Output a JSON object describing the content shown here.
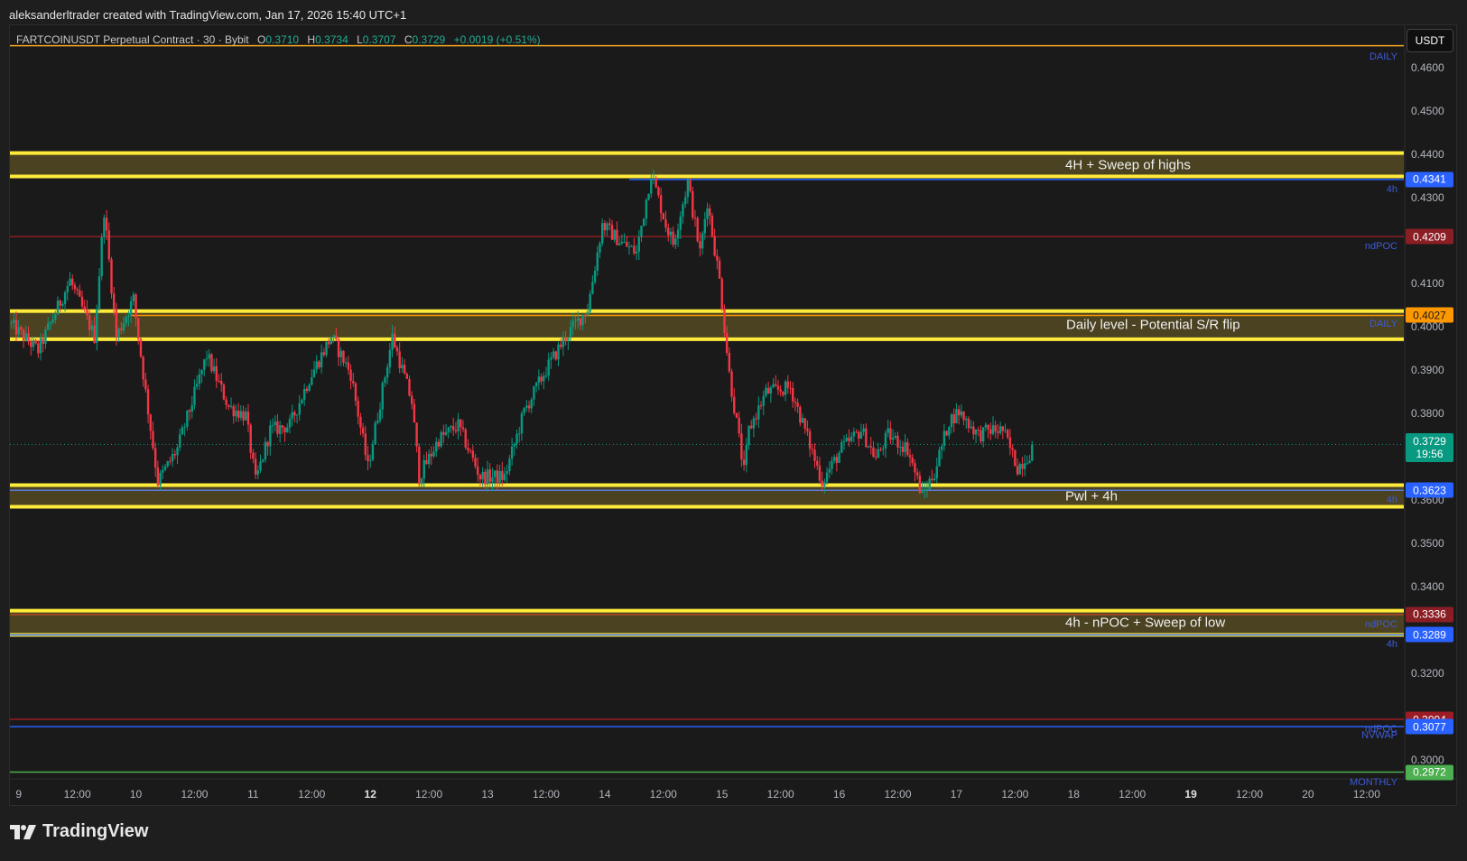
{
  "credit": "aleksanderltrader created with TradingView.com, Jan 17, 2026 15:40 UTC+1",
  "legend": {
    "symbol": "FARTCOINUSDT Perpetual Contract · 30 · Bybit",
    "o_label": "O",
    "o": "0.3710",
    "h_label": "H",
    "h": "0.3734",
    "l_label": "L",
    "l": "0.3707",
    "c_label": "C",
    "c": "0.3729",
    "change": "+0.0019 (+0.51%)"
  },
  "currency_button": "USDT",
  "brand": "TradingView",
  "chart_data": {
    "type": "candlestick",
    "timeframe": "30",
    "ylim": [
      0.2955,
      0.467
    ],
    "y_ticks": [
      "0.4600",
      "0.4500",
      "0.4400",
      "0.4300",
      "0.4100",
      "0.4000",
      "0.3900",
      "0.3800",
      "0.3600",
      "0.3500",
      "0.3400",
      "0.3200",
      "0.3000"
    ],
    "x_ticks": [
      {
        "t": "2026-01-09T00:00",
        "label": "9"
      },
      {
        "t": "2026-01-09T12:00",
        "label": "12:00"
      },
      {
        "t": "2026-01-10T00:00",
        "label": "10"
      },
      {
        "t": "2026-01-10T12:00",
        "label": "12:00"
      },
      {
        "t": "2026-01-11T00:00",
        "label": "11"
      },
      {
        "t": "2026-01-11T12:00",
        "label": "12:00"
      },
      {
        "t": "2026-01-12T00:00",
        "label": "12",
        "bold": true
      },
      {
        "t": "2026-01-12T12:00",
        "label": "12:00"
      },
      {
        "t": "2026-01-13T00:00",
        "label": "13"
      },
      {
        "t": "2026-01-13T12:00",
        "label": "12:00"
      },
      {
        "t": "2026-01-14T00:00",
        "label": "14"
      },
      {
        "t": "2026-01-14T12:00",
        "label": "12:00"
      },
      {
        "t": "2026-01-15T00:00",
        "label": "15"
      },
      {
        "t": "2026-01-15T12:00",
        "label": "12:00"
      },
      {
        "t": "2026-01-16T00:00",
        "label": "16"
      },
      {
        "t": "2026-01-16T12:00",
        "label": "12:00"
      },
      {
        "t": "2026-01-17T00:00",
        "label": "17"
      },
      {
        "t": "2026-01-17T12:00",
        "label": "12:00"
      },
      {
        "t": "2026-01-18T00:00",
        "label": "18"
      },
      {
        "t": "2026-01-18T12:00",
        "label": "12:00"
      },
      {
        "t": "2026-01-19T00:00",
        "label": "19",
        "bold": true
      },
      {
        "t": "2026-01-19T12:00",
        "label": "12:00"
      },
      {
        "t": "2026-01-20T00:00",
        "label": "20"
      },
      {
        "t": "2026-01-20T12:00",
        "label": "12:00"
      }
    ],
    "price_path": [
      [
        "2026-01-08T22:00",
        0.401
      ],
      [
        "2026-01-09T04:00",
        0.3946
      ],
      [
        "2026-01-09T10:30",
        0.4108
      ],
      [
        "2026-01-09T15:30",
        0.3978
      ],
      [
        "2026-01-09T17:30",
        0.427
      ],
      [
        "2026-01-09T20:00",
        0.3978
      ],
      [
        "2026-01-09T23:30",
        0.4065
      ],
      [
        "2026-01-10T02:00",
        0.3849
      ],
      [
        "2026-01-10T04:30",
        0.3643
      ],
      [
        "2026-01-10T08:30",
        0.3719
      ],
      [
        "2026-01-10T14:30",
        0.3935
      ],
      [
        "2026-01-10T19:00",
        0.3816
      ],
      [
        "2026-01-10T22:30",
        0.3795
      ],
      [
        "2026-01-11T00:30",
        0.3643
      ],
      [
        "2026-01-11T03:30",
        0.3762
      ],
      [
        "2026-01-11T07:30",
        0.3773
      ],
      [
        "2026-01-11T11:30",
        0.3881
      ],
      [
        "2026-01-11T16:00",
        0.3978
      ],
      [
        "2026-01-11T20:00",
        0.3892
      ],
      [
        "2026-01-11T23:30",
        0.3676
      ],
      [
        "2026-01-12T04:30",
        0.3978
      ],
      [
        "2026-01-12T08:30",
        0.3827
      ],
      [
        "2026-01-12T10:00",
        0.3654
      ],
      [
        "2026-01-12T14:00",
        0.3741
      ],
      [
        "2026-01-12T18:00",
        0.3773
      ],
      [
        "2026-01-12T22:30",
        0.3654
      ],
      [
        "2026-01-13T03:30",
        0.3654
      ],
      [
        "2026-01-13T07:30",
        0.3805
      ],
      [
        "2026-01-13T11:30",
        0.3892
      ],
      [
        "2026-01-13T16:00",
        0.3978
      ],
      [
        "2026-01-13T20:30",
        0.4043
      ],
      [
        "2026-01-13T23:30",
        0.4237
      ],
      [
        "2026-01-14T03:30",
        0.4194
      ],
      [
        "2026-01-14T06:30",
        0.4172
      ],
      [
        "2026-01-14T09:30",
        0.4356
      ],
      [
        "2026-01-14T12:30",
        0.4237
      ],
      [
        "2026-01-14T14:00",
        0.4194
      ],
      [
        "2026-01-14T17:00",
        0.4334
      ],
      [
        "2026-01-14T19:30",
        0.4172
      ],
      [
        "2026-01-14T21:00",
        0.4291
      ],
      [
        "2026-01-14T23:30",
        0.4108
      ],
      [
        "2026-01-15T01:30",
        0.3892
      ],
      [
        "2026-01-15T04:30",
        0.3665
      ],
      [
        "2026-01-15T05:30",
        0.3762
      ],
      [
        "2026-01-15T09:00",
        0.3849
      ],
      [
        "2026-01-15T14:00",
        0.386
      ],
      [
        "2026-01-15T17:00",
        0.3762
      ],
      [
        "2026-01-15T20:30",
        0.3643
      ],
      [
        "2026-01-16T00:30",
        0.3719
      ],
      [
        "2026-01-16T04:30",
        0.3762
      ],
      [
        "2026-01-16T07:30",
        0.3697
      ],
      [
        "2026-01-16T10:00",
        0.3751
      ],
      [
        "2026-01-16T14:00",
        0.3719
      ],
      [
        "2026-01-16T17:00",
        0.3611
      ],
      [
        "2026-01-16T19:30",
        0.3665
      ],
      [
        "2026-01-16T22:30",
        0.3784
      ],
      [
        "2026-01-17T00:30",
        0.3805
      ],
      [
        "2026-01-17T04:30",
        0.3751
      ],
      [
        "2026-01-17T07:00",
        0.3762
      ],
      [
        "2026-01-17T09:30",
        0.3762
      ],
      [
        "2026-01-17T12:30",
        0.3676
      ],
      [
        "2026-01-17T15:00",
        0.3708
      ],
      [
        "2026-01-17T15:30",
        0.3729
      ]
    ],
    "last_price": {
      "value": "0.3729",
      "countdown": "19:56",
      "color": "#089981"
    },
    "zones": [
      {
        "top": 0.4402,
        "bottom": 0.4348,
        "label": "4H + Sweep of highs"
      },
      {
        "top": 0.4037,
        "bottom": 0.3972,
        "label": "Daily level - Potential S/R flip"
      },
      {
        "top": 0.3635,
        "bottom": 0.3585,
        "label": "Pwl + 4h"
      },
      {
        "top": 0.3345,
        "bottom": 0.3289,
        "label": "4h - nPOC + Sweep of low"
      }
    ],
    "levels": [
      {
        "price": 0.465,
        "color": "#f5a623",
        "tag": "DAILY"
      },
      {
        "price": 0.4341,
        "color": "#2962ff",
        "tag": "4h",
        "badge": "0.4341",
        "start": "2026-01-14T05:00"
      },
      {
        "price": 0.4209,
        "color": "#8b1e24",
        "tag": "ndPOC",
        "badge": "0.4209"
      },
      {
        "price": 0.4027,
        "color": "#ff9800",
        "tag": "DAILY",
        "badge": "0.4027",
        "start": "2026-01-09T23:00"
      },
      {
        "price": 0.3623,
        "color": "#5b7bd6",
        "tag": "4h",
        "badge": "0.3623"
      },
      {
        "price": 0.3336,
        "color": "#b24a2a",
        "tag": "ndPOC",
        "badge": "0.3336"
      },
      {
        "price": 0.3289,
        "color": "#2962ff",
        "tag": "4h",
        "badge": "0.3289"
      },
      {
        "price": 0.3094,
        "color": "#9b1c24",
        "tag": "ndPOC",
        "badge": "0.3094"
      },
      {
        "price": 0.3077,
        "color": "#2962ff",
        "tag": "NVWAP",
        "badge": "0.3077"
      },
      {
        "price": 0.2972,
        "color": "#4caf50",
        "tag": "MONTHLY",
        "badge": "0.2972"
      }
    ],
    "colors": {
      "up": "#089981",
      "down": "#f23645",
      "zone_fill": "#4a4220",
      "zone_border": "#ffeb3b"
    },
    "grid": false
  }
}
